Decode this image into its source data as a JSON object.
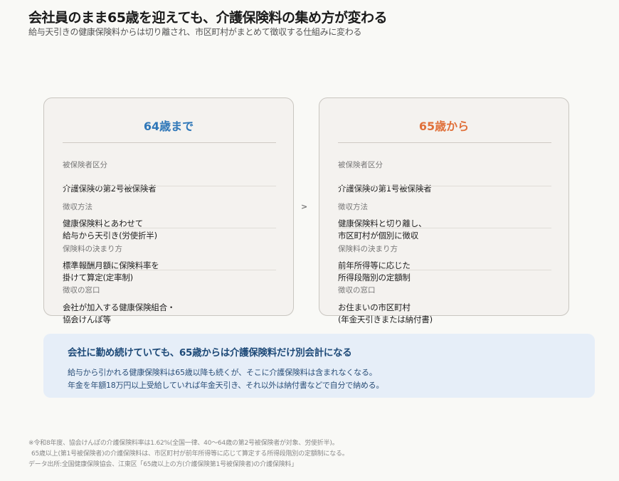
{
  "header": {
    "title": "会社員のまま65歳を迎えても、介護保険料の集め方が変わる",
    "subtitle": "給与天引きの健康保険料からは切り離され、市区町村がまとめて徴収する仕組みに変わる"
  },
  "cards": {
    "left": {
      "heading": "64歳まで",
      "label_1": "被保険者区分",
      "value_1": [
        "介護保険の第2号被保険者"
      ],
      "label_2": "徴収方法",
      "value_2": [
        "健康保険料とあわせて",
        "給与から天引き(労使折半)"
      ],
      "label_3": "保険料の決まり方",
      "value_3": [
        "標準報酬月額に保険料率を",
        "掛けて算定(定率制)"
      ],
      "label_4": "徴収の窓口",
      "value_4": [
        "会社が加入する健康保険組合・",
        "協会けんぽ等"
      ]
    },
    "right": {
      "heading": "65歳から",
      "label_1": "被保険者区分",
      "value_1": [
        "介護保険の第1号被保険者"
      ],
      "label_2": "徴収方法",
      "value_2": [
        "健康保険料と切り離し、",
        "市区町村が個別に徴収"
      ],
      "label_3": "保険料の決まり方",
      "value_3": [
        "前年所得等に応じた",
        "所得段階別の定額制"
      ],
      "label_4": "徴収の窓口",
      "value_4": [
        "お住まいの市区町村",
        "(年金天引きまたは納付書)"
      ]
    },
    "arrow": ">"
  },
  "note": {
    "title": "会社に勤め続けていても、65歳からは介護保険料だけ別会計になる",
    "line_1": "給与から引かれる健康保険料は65歳以降も続くが、そこに介護保険料は含まれなくなる。",
    "line_2": "年金を年額18万円以上受給していれば年金天引き、それ以外は納付書などで自分で納める。"
  },
  "footnotes": {
    "line_1": "※令和8年度、協会けんぽの介護保険料率は1.62%(全国一律、40〜64歳の第2号被保険者が対象、労使折半)。",
    "line_2": "65歳以上(第1号被保険者)の介護保険料は、市区町村が前年所得等に応じて算定する所得段階別の定額制になる。",
    "line_3": "データ出所:全国健康保険協会、江東区「65歳以上の方(介護保険第1号被保険者)の介護保険料」"
  }
}
